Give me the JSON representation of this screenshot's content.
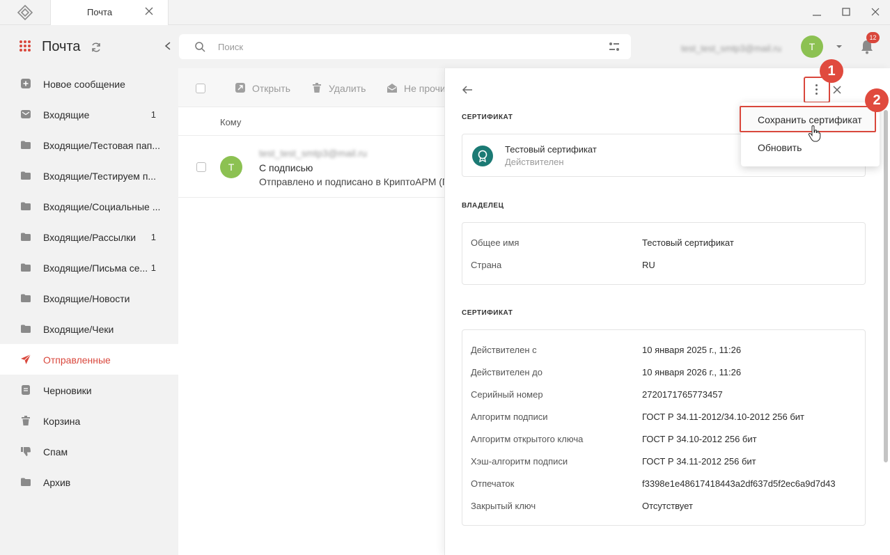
{
  "titlebar": {
    "tab_label": "Почта"
  },
  "header": {
    "app_title": "Почта",
    "search_placeholder": "Поиск",
    "user_email": "test_test_smtp3@mail.ru",
    "avatar_letter": "Т",
    "notifications_count": "12"
  },
  "sidebar": {
    "items": [
      {
        "label": "Новое сообщение",
        "count": "",
        "icon": "plus-square-icon"
      },
      {
        "label": "Входящие",
        "count": "1",
        "icon": "envelope-icon"
      },
      {
        "label": "Входящие/Тестовая пап...",
        "count": "",
        "icon": "folder-icon"
      },
      {
        "label": "Входящие/Тестируем п...",
        "count": "",
        "icon": "folder-icon"
      },
      {
        "label": "Входящие/Социальные ...",
        "count": "",
        "icon": "folder-icon"
      },
      {
        "label": "Входящие/Рассылки",
        "count": "1",
        "icon": "folder-icon"
      },
      {
        "label": "Входящие/Письма се...",
        "count": "1",
        "icon": "folder-icon"
      },
      {
        "label": "Входящие/Новости",
        "count": "",
        "icon": "folder-icon"
      },
      {
        "label": "Входящие/Чеки",
        "count": "",
        "icon": "folder-icon"
      },
      {
        "label": "Отправленные",
        "count": "",
        "icon": "send-icon",
        "active": true
      },
      {
        "label": "Черновики",
        "count": "",
        "icon": "draft-icon"
      },
      {
        "label": "Корзина",
        "count": "",
        "icon": "trash-icon"
      },
      {
        "label": "Спам",
        "count": "",
        "icon": "thumb-down-icon"
      },
      {
        "label": "Архив",
        "count": "",
        "icon": "folder-icon"
      }
    ]
  },
  "list": {
    "toolbar": {
      "open_label": "Открыть",
      "delete_label": "Удалить",
      "unread_label": "Не прочи"
    },
    "column_header": "Кому",
    "messages": [
      {
        "avatar": "Т",
        "from": "test_test_smtp3@mail.ru",
        "subject": "С подписью",
        "preview": "Отправлено и подписано в КриптоАРМ (Г"
      }
    ]
  },
  "detail": {
    "section_cert_title": "СЕРТИФИКАТ",
    "cert_name": "Тестовый сертификат",
    "cert_status": "Действителен",
    "section_owner_title": "ВЛАДЕЛЕЦ",
    "owner": [
      {
        "key": "Общее имя",
        "value": "Тестовый сертификат"
      },
      {
        "key": "Страна",
        "value": "RU"
      }
    ],
    "section_details_title": "СЕРТИФИКАТ",
    "details": [
      {
        "key": "Действителен с",
        "value": "10 января 2025 г., 11:26"
      },
      {
        "key": "Действителен до",
        "value": "10 января 2026 г., 11:26"
      },
      {
        "key": "Серийный номер",
        "value": "2720171765773457"
      },
      {
        "key": "Алгоритм подписи",
        "value": "ГОСТ Р 34.11-2012/34.10-2012 256 бит"
      },
      {
        "key": "Алгоритм открытого ключа",
        "value": "ГОСТ Р 34.10-2012 256 бит"
      },
      {
        "key": "Хэш-алгоритм подписи",
        "value": "ГОСТ Р 34.11-2012 256 бит"
      },
      {
        "key": "Отпечаток",
        "value": "f3398e1e48617418443a2df637d5f2ec6a9d7d43"
      },
      {
        "key": "Закрытый ключ",
        "value": "Отсутствует"
      }
    ]
  },
  "menu": {
    "items": [
      {
        "label": "Сохранить сертификат"
      },
      {
        "label": "Обновить"
      }
    ]
  },
  "annotations": {
    "step1": "1",
    "step2": "2"
  },
  "colors": {
    "accent": "#d9473c",
    "avatar": "#8cc152",
    "cert_badge": "#1b7a74"
  }
}
